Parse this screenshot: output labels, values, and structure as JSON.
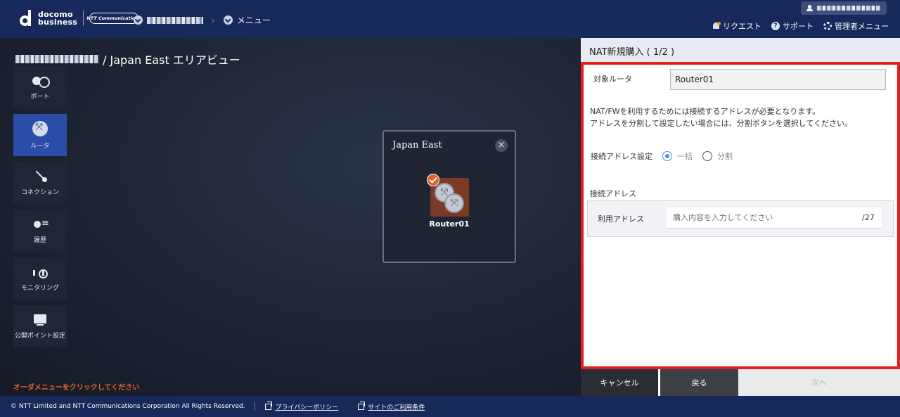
{
  "header": {
    "logo_line1": "docomo",
    "logo_line2": "business",
    "ntt_logo": "NTT Communications",
    "menu_crumb": "メニュー",
    "nav": {
      "request": "リクエスト",
      "support": "サポート",
      "admin_menu": "管理者メニュー"
    }
  },
  "main": {
    "title": "/ Japan East エリアビュー",
    "order_hint": "オーダメニューをクリックしてください"
  },
  "sidebar": {
    "items": [
      {
        "label": "ポート",
        "icon": "port-icon"
      },
      {
        "label": "ルータ",
        "icon": "router-icon",
        "active": true
      },
      {
        "label": "コネクション",
        "icon": "connection-icon"
      },
      {
        "label": "履歴",
        "icon": "history-icon"
      },
      {
        "label": "モニタリング",
        "icon": "monitoring-icon"
      },
      {
        "label": "公開ポイント設定",
        "icon": "public-point-icon"
      }
    ]
  },
  "area_view": {
    "title": "Japan East",
    "router_label": "Router01"
  },
  "panel": {
    "title": "NAT新規購入 ( 1/2 )",
    "target_router_label": "対象ルータ",
    "target_router_value": "Router01",
    "desc_line1": "NAT/FWを利用するためには接続するアドレスが必要となります。",
    "desc_line2": "アドレスを分割して設定したい場合には、分割ボタンを選択してください。",
    "conn_setting_label": "接続アドレス設定",
    "radio_bulk": "一括",
    "radio_split": "分割",
    "conn_address_label": "接続アドレス",
    "use_address_label": "利用アドレス",
    "use_address_placeholder": "購入内容を入力してください",
    "use_address_suffix": "/27",
    "buttons": {
      "cancel": "キャンセル",
      "back": "戻る",
      "next": "次へ"
    }
  },
  "footer": {
    "copyright": "© NTT Limited and NTT Communications Corporation All Rights Reserved.",
    "privacy": "プライバシーポリシー",
    "terms": "サイトのご利用条件"
  },
  "colors": {
    "header_bg": "#17285a",
    "accent_active": "#2a4da8",
    "highlight_border": "#e61e1e",
    "hint_orange": "#e8632a",
    "router_tile": "#7a3a26"
  }
}
